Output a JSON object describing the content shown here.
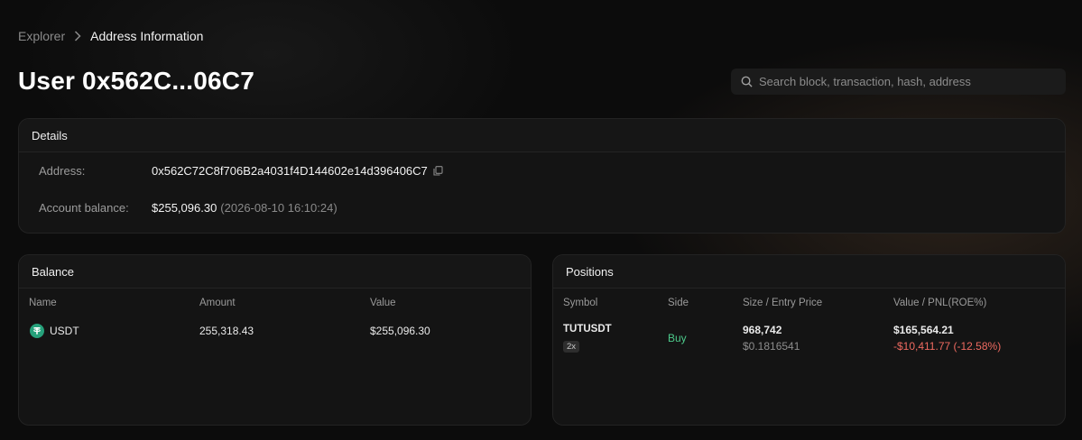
{
  "breadcrumb": {
    "root": "Explorer",
    "current": "Address Information"
  },
  "page_title": "User 0x562C...06C7",
  "search": {
    "placeholder": "Search block, transaction, hash, address",
    "value": ""
  },
  "details": {
    "header": "Details",
    "address_label": "Address:",
    "address_value": "0x562C72C8f706B2a4031f4D144602e14d396406C7",
    "balance_label": "Account balance:",
    "balance_value": "$255,096.30",
    "balance_timestamp": "(2026-08-10 16:10:24)"
  },
  "balance": {
    "header": "Balance",
    "columns": [
      "Name",
      "Amount",
      "Value"
    ],
    "rows": [
      {
        "name": "USDT",
        "amount": "255,318.43",
        "value": "$255,096.30",
        "icon": "tether-icon"
      }
    ]
  },
  "positions": {
    "header": "Positions",
    "columns": [
      "Symbol",
      "Side",
      "Size / Entry Price",
      "Value / PNL(ROE%)"
    ],
    "rows": [
      {
        "symbol": "TUTUSDT",
        "leverage": "2x",
        "side": "Buy",
        "size": "968,742",
        "entry_price": "$0.1816541",
        "value": "$165,564.21",
        "pnl": "-$10,411.77 (-12.58%)"
      }
    ]
  },
  "colors": {
    "buy": "#4cc98a",
    "negative": "#ee6a60",
    "tether": "#26a17b"
  }
}
